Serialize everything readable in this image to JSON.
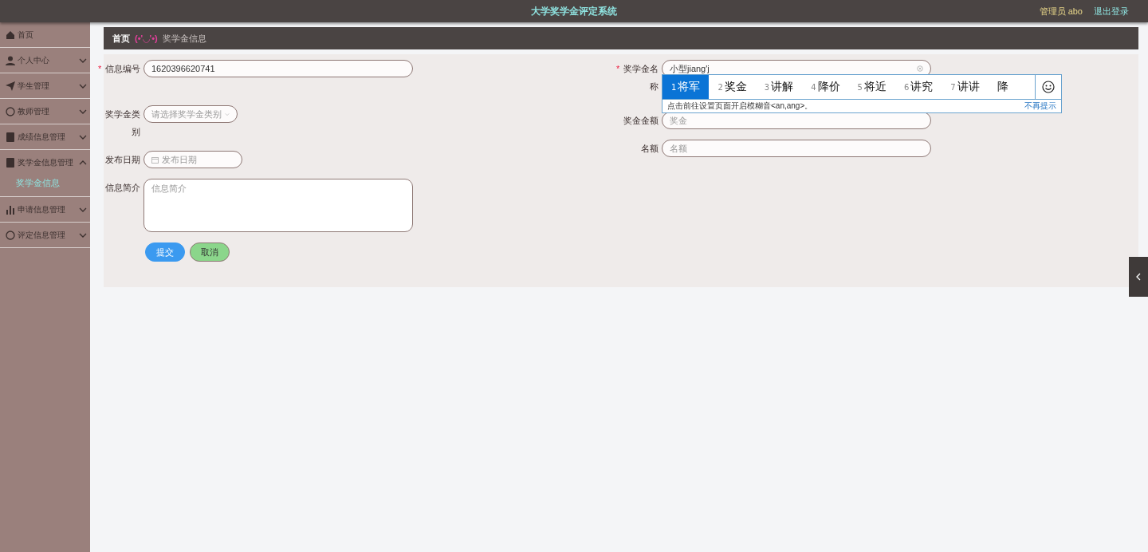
{
  "header": {
    "title": "大学奖学金评定系统",
    "user": "管理员 abo",
    "logout": "退出登录"
  },
  "sidebar": {
    "items": [
      {
        "label": "首页"
      },
      {
        "label": "个人中心",
        "expanded": false
      },
      {
        "label": "学生管理",
        "expanded": false
      },
      {
        "label": "教师管理",
        "expanded": false
      },
      {
        "label": "成绩信息管理",
        "expanded": false
      },
      {
        "label": "奖学金信息管理",
        "expanded": true,
        "children": [
          {
            "label": "奖学金信息",
            "selected": true
          }
        ]
      },
      {
        "label": "申请信息管理",
        "expanded": false
      },
      {
        "label": "评定信息管理",
        "expanded": false
      }
    ]
  },
  "breadcrumb": {
    "home": "首页",
    "separator": "(•'◡'•)",
    "current": "奖学金信息"
  },
  "form": {
    "left": [
      {
        "kind": "text",
        "label": "信息编号",
        "marker": "*",
        "value": "1620396620741"
      },
      {
        "kind": "select",
        "label": "奖学金类别",
        "placeholder": "请选择奖学金类别"
      },
      {
        "kind": "date",
        "label": "发布日期",
        "placeholder": "发布日期"
      },
      {
        "kind": "textarea",
        "label": "信息简介",
        "placeholder": "信息简介"
      }
    ],
    "right": [
      {
        "kind": "text",
        "label": "奖学金名称",
        "marker": "*",
        "value": "小型jiang'j",
        "clearable": true
      },
      {
        "kind": "text",
        "label": "奖金金额",
        "placeholder": "奖金"
      },
      {
        "kind": "text",
        "label": "名额",
        "placeholder": "名额"
      }
    ],
    "buttons": [
      {
        "label": "提交",
        "kind": "primary"
      },
      {
        "label": "取消",
        "kind": "secondary"
      }
    ]
  },
  "ime": {
    "candidates": [
      {
        "index": "1",
        "text": "将军",
        "selected": true
      },
      {
        "index": "2",
        "text": "奖金",
        "selected": false
      },
      {
        "index": "3",
        "text": "讲解",
        "selected": false
      },
      {
        "index": "4",
        "text": "降价",
        "selected": false
      },
      {
        "index": "5",
        "text": "将近",
        "selected": false
      },
      {
        "index": "6",
        "text": "讲究",
        "selected": false
      },
      {
        "index": "7",
        "text": "讲讲",
        "selected": false
      },
      {
        "text": "降",
        "selected": false
      }
    ],
    "hint": "点击前往设置页面开启模糊音<an,ang>。",
    "dismiss": "不再提示"
  }
}
